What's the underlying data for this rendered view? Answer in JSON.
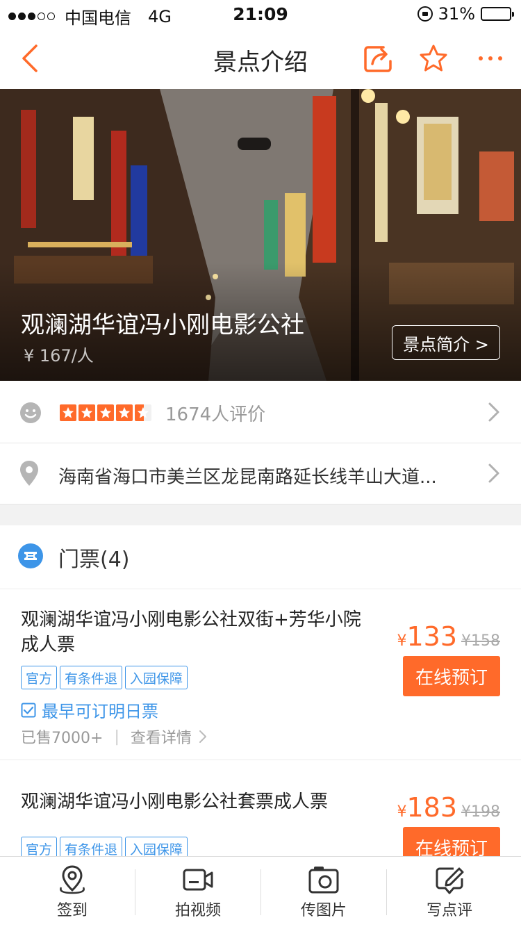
{
  "status_bar": {
    "carrier": "中国电信",
    "network": "4G",
    "time": "21:09",
    "battery": "31%",
    "battery_level": 0.31
  },
  "nav": {
    "title": "景点介绍",
    "icons": [
      "back-icon",
      "share-icon",
      "star-icon",
      "more-icon"
    ]
  },
  "hero": {
    "title": "观澜湖华谊冯小刚电影公社",
    "price": "¥ 167/人",
    "intro_button": "景点简介 >"
  },
  "rating": {
    "stars": 4.5,
    "count_text": "1674人评价"
  },
  "address": {
    "text": "海南省海口市美兰区龙昆南路延长线羊山大道..."
  },
  "tickets": {
    "header": "门票(4)",
    "items": [
      {
        "name": "观澜湖华谊冯小刚电影公社双街+芳华小院成人票",
        "tags": [
          "官方",
          "有条件退",
          "入园保障"
        ],
        "note": "最早可订明日票",
        "sold": "已售7000+",
        "details": "查看详情",
        "currency": "¥",
        "price": "133",
        "original_price": "¥158",
        "button": "在线预订"
      },
      {
        "name": "观澜湖华谊冯小刚电影公社套票成人票",
        "tags": [
          "官方",
          "有条件退",
          "入园保障"
        ],
        "currency": "¥",
        "price": "183",
        "original_price": "¥198",
        "button": "在线预订"
      }
    ]
  },
  "tab_bar": {
    "items": [
      {
        "label": "签到",
        "icon": "checkin-pin-icon"
      },
      {
        "label": "拍视频",
        "icon": "video-camera-icon"
      },
      {
        "label": "传图片",
        "icon": "photo-upload-icon"
      },
      {
        "label": "写点评",
        "icon": "write-review-icon"
      }
    ]
  },
  "colors": {
    "accent": "#ff6a2a",
    "link_blue": "#3d95e8"
  }
}
